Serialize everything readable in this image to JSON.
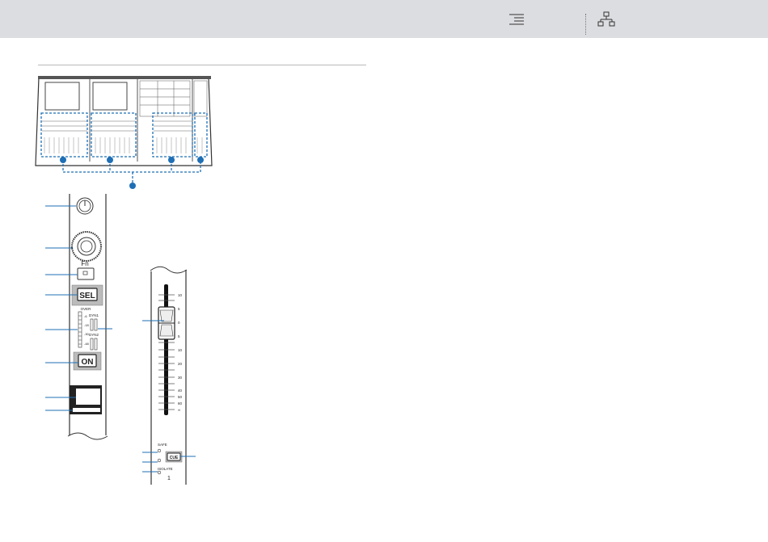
{
  "toolbar": {
    "toc_icon": "table-of-contents-icon",
    "sitemap_icon": "hierarchy-icon"
  },
  "console_strip": {
    "fn_label": "Fn",
    "sel_label": "SEL",
    "on_label": "ON",
    "meter_title": "OVER",
    "meter_scale": [
      "-6",
      "-18",
      "-30",
      "-48"
    ],
    "dyn1_label": "DYN1",
    "dyn2_label": "DYN2"
  },
  "fader_strip": {
    "scale": [
      "10",
      "5",
      "0",
      "5",
      "10",
      "20",
      "30",
      "40",
      "50",
      "60",
      "∞"
    ],
    "safe_label": "SAFE",
    "isolate_label": "ISOLATE",
    "cue_label": "CUE",
    "channel_number": "1"
  },
  "colors": {
    "topbar": "#dcdde0",
    "callout": "#1f6fb5",
    "panel_dark": "#333333"
  }
}
